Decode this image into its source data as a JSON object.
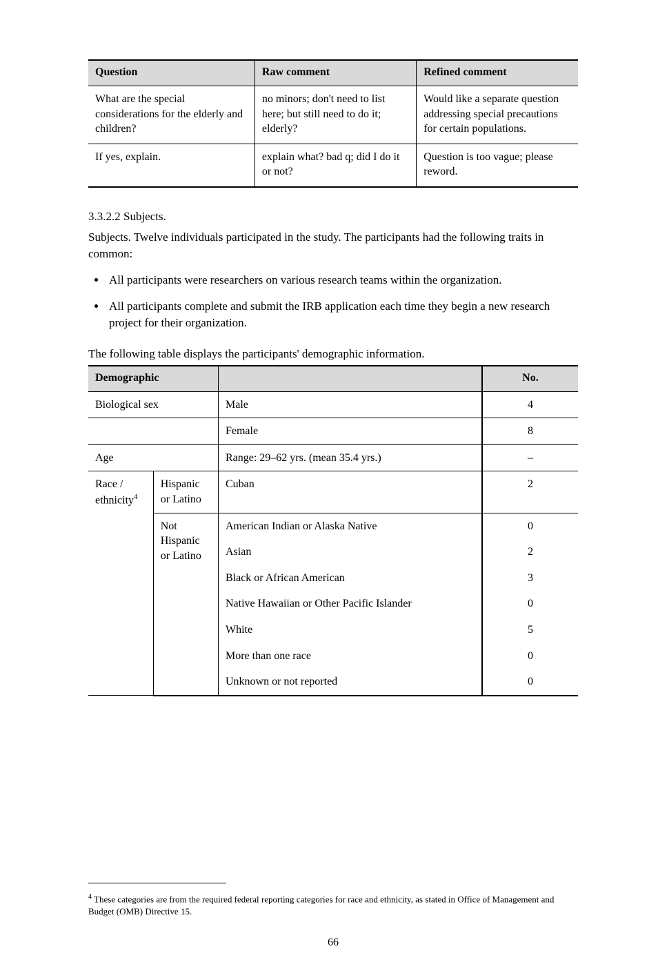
{
  "table1": {
    "headers": [
      "Question",
      "Raw comment",
      "Refined comment"
    ],
    "rows": [
      [
        "What are the special considerations for the elderly and children?",
        "no minors; don't need to list here; but still need to do it; elderly?",
        "Would like a separate question addressing special precautions for certain populations."
      ],
      [
        "If yes, explain.",
        "explain what? bad q; did I do it or not?",
        "Question is too vague; please reword."
      ]
    ]
  },
  "section": {
    "sub": "3.3.2.2 Subjects.",
    "p1": "Subjects. Twelve individuals participated in the study. The participants had the following traits in common:",
    "b1": "All participants were researchers on various research teams within the organization.",
    "b2": "All participants complete and submit the IRB application each time they begin a new research project for their organization.",
    "tc": "The following table displays the participants' demographic information.",
    "fn": "4 These categories are from the required federal reporting categories for race and ethnicity, as stated in Office of Management and Budget (OMB) Directive 15."
  },
  "table2": {
    "headers": [
      "Demographic",
      "",
      "",
      "No."
    ],
    "rows_simple": [
      [
        "Biological sex",
        "",
        "Male",
        "4"
      ],
      [
        "",
        "",
        "Female",
        "8"
      ],
      [
        "Age",
        "",
        "Range: 29–62 yrs. (mean 35.4 yrs.)",
        "–"
      ]
    ],
    "r4": {
      "c1": "Race / ethnicity",
      "sub1": {
        "c2": "Hispanic or Latino",
        "c3": "Cuban",
        "c4": "2"
      },
      "sub2": {
        "c2": "Not Hispanic or Latino",
        "items": [
          "American Indian or Alaska Native",
          "Asian",
          "Black or African American",
          "Native Hawaiian or Other Pacific Islander",
          "White",
          "More than one race",
          "Unknown or not reported"
        ],
        "nums": [
          "0",
          "2",
          "3",
          "0",
          "5",
          "0",
          "0"
        ]
      }
    }
  },
  "footer": {
    "page": "66"
  }
}
